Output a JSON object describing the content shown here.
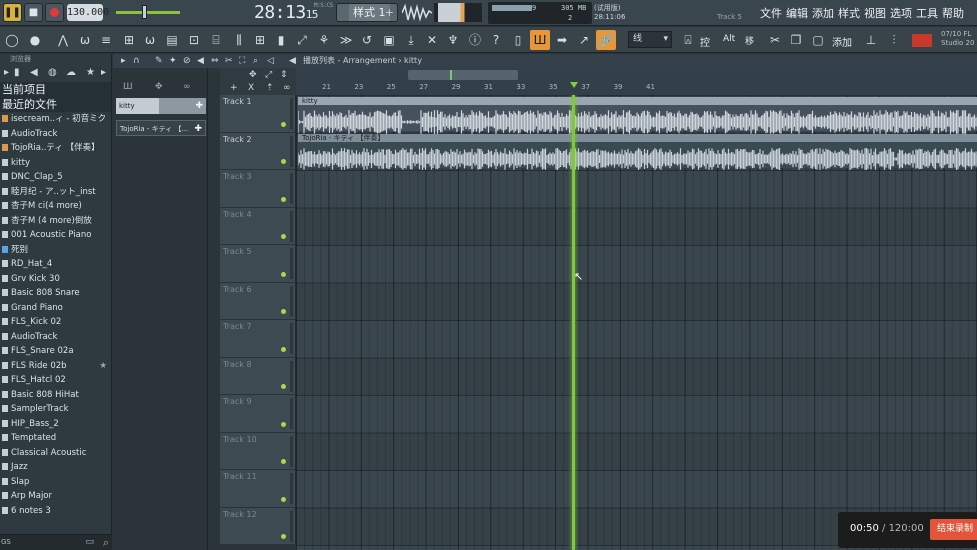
{
  "transport": {
    "play_icon": "pause-icon",
    "tempo": "130.000",
    "time_main": "28:13",
    "time_sub": "15",
    "time_unit": "M:S:CS",
    "pattern_label": "样式 1",
    "pattern_add": "+"
  },
  "sysmon": {
    "cpu": "9",
    "memory": "305 MB",
    "polyphony": "2"
  },
  "hint": {
    "line1": "(试用版)",
    "line2": "28:11:06",
    "right": "Track 5"
  },
  "menu": [
    "文件",
    "编辑",
    "添加",
    "样式",
    "视图",
    "选项",
    "工具",
    "帮助"
  ],
  "toolbar": {
    "snap_value": "线",
    "label_kong": "控",
    "label_alt": "Alt",
    "label_yi": "移",
    "label_add": "添加",
    "fl_info_line1": "07/10 FL",
    "fl_info_line2": "Studio 20"
  },
  "browser": {
    "header": "浏览器",
    "section_current": "当前项目",
    "section_recent": "最近的文件",
    "items": [
      {
        "label": "isecream..ィ - 初音ミク",
        "icon": "audio"
      },
      {
        "label": "AudioTrack",
        "icon": "wave"
      },
      {
        "label": "TojoRia..ティ 【伴奏】",
        "icon": "audio"
      },
      {
        "label": "kitty",
        "icon": "wave"
      },
      {
        "label": "DNC_Clap_5",
        "icon": "wave"
      },
      {
        "label": "睦月纪 - ア..ット_inst",
        "icon": "wave"
      },
      {
        "label": "杏子M ci(4 more)",
        "icon": "wave"
      },
      {
        "label": "杏子M (4 more)倒放",
        "icon": "wave"
      },
      {
        "label": "001 Acoustic Piano",
        "icon": "wave"
      },
      {
        "label": "死别",
        "icon": "blue"
      },
      {
        "label": "RD_Hat_4",
        "icon": "wave"
      },
      {
        "label": "Grv Kick 30",
        "icon": "wave"
      },
      {
        "label": "Basic 808 Snare",
        "icon": "wave"
      },
      {
        "label": "Grand Piano",
        "icon": "wave"
      },
      {
        "label": "FLS_Kick 02",
        "icon": "wave"
      },
      {
        "label": "AudioTrack",
        "icon": "wave"
      },
      {
        "label": "FLS_Snare 02a",
        "icon": "wave"
      },
      {
        "label": "FLS Ride 02b",
        "icon": "wave",
        "star": "★"
      },
      {
        "label": "FLS_Hatcl 02",
        "icon": "wave"
      },
      {
        "label": "Basic 808 HiHat",
        "icon": "wave"
      },
      {
        "label": "SamplerTrack",
        "icon": "wave"
      },
      {
        "label": "HIP_Bass_2",
        "icon": "wave"
      },
      {
        "label": "Temptated",
        "icon": "wave"
      },
      {
        "label": "Classical Acoustic",
        "icon": "wave"
      },
      {
        "label": "Jazz",
        "icon": "wave"
      },
      {
        "label": "Slap",
        "icon": "wave"
      },
      {
        "label": "Arp Major",
        "icon": "wave"
      },
      {
        "label": "6 notes 3",
        "icon": "wave"
      }
    ],
    "search_text": "GS"
  },
  "playlist": {
    "title": "播放列表 - Arrangement › kitty",
    "clip_sources": [
      "kitty",
      "TojoRia - キティ 【..."
    ],
    "bar_numbers": [
      "21",
      "23",
      "25",
      "27",
      "29",
      "31",
      "33",
      "35",
      "37",
      "39",
      "41"
    ],
    "tracks": [
      "Track 1",
      "Track 2",
      "Track 3",
      "Track 4",
      "Track 5",
      "Track 6",
      "Track 7",
      "Track 8",
      "Track 9",
      "Track 10",
      "Track 11",
      "Track 12"
    ],
    "clips": [
      {
        "title": "kitty",
        "track": 1
      },
      {
        "title": "TojoRia - キティ 【伴奏】",
        "track": 2
      }
    ]
  },
  "recording": {
    "elapsed": "00:50",
    "separator": " / ",
    "total": "120:00",
    "stop_label": "结束录制"
  },
  "colors": {
    "accent_orange": "#e8963a",
    "playhead_green": "#7fc93a",
    "record_red": "#e2553a"
  }
}
